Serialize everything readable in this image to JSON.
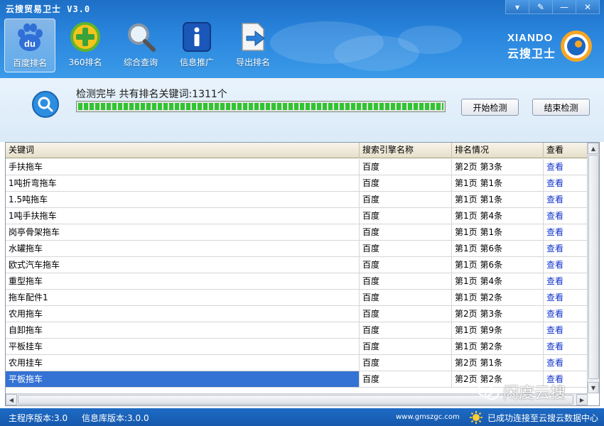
{
  "window": {
    "title": "云搜贸易卫士 V3.0",
    "controls": [
      "▾",
      "✎",
      "—",
      "✕"
    ]
  },
  "toolbar": {
    "items": [
      {
        "label": "百度排名",
        "icon": "baidu-paw-icon",
        "active": true
      },
      {
        "label": "360排名",
        "icon": "360-plus-icon",
        "active": false
      },
      {
        "label": "综合查询",
        "icon": "magnifier-icon",
        "active": false
      },
      {
        "label": "信息推广",
        "icon": "info-icon",
        "active": false
      },
      {
        "label": "导出排名",
        "icon": "export-document-icon",
        "active": false
      }
    ],
    "icon_badge": "du"
  },
  "brand": {
    "en": "XIANDO",
    "cn": "云搜卫士"
  },
  "status": {
    "message": "检测完毕 共有排名关键词:1311个",
    "progress": 1.0
  },
  "buttons": {
    "start": "开始检测",
    "stop": "结束检测"
  },
  "table": {
    "columns": [
      "关键词",
      "搜索引擎名称",
      "排名情况",
      "查看"
    ],
    "rows": [
      [
        "手扶拖车",
        "百度",
        "第2页 第3条",
        "查看"
      ],
      [
        "1吨折弯拖车",
        "百度",
        "第1页 第1条",
        "查看"
      ],
      [
        "1.5吨拖车",
        "百度",
        "第1页 第1条",
        "查看"
      ],
      [
        "1吨手扶拖车",
        "百度",
        "第1页 第4条",
        "查看"
      ],
      [
        "岗亭骨架拖车",
        "百度",
        "第1页 第1条",
        "查看"
      ],
      [
        "水罐拖车",
        "百度",
        "第1页 第6条",
        "查看"
      ],
      [
        "欧式汽车拖车",
        "百度",
        "第1页 第6条",
        "查看"
      ],
      [
        "重型拖车",
        "百度",
        "第1页 第4条",
        "查看"
      ],
      [
        "拖车配件1",
        "百度",
        "第1页 第2条",
        "查看"
      ],
      [
        "农用拖车",
        "百度",
        "第2页 第3条",
        "查看"
      ],
      [
        "自卸拖车",
        "百度",
        "第1页 第9条",
        "查看"
      ],
      [
        "平板挂车",
        "百度",
        "第1页 第2条",
        "查看"
      ],
      [
        "农用挂车",
        "百度",
        "第2页 第1条",
        "查看"
      ],
      [
        "平板拖车",
        "百度",
        "第2页 第2条",
        "查看"
      ]
    ],
    "selected_row": 13
  },
  "statusbar": {
    "main_version": "主程序版本:3.0",
    "db_version": "信息库版本:3.0.0",
    "url": "www.gmszgc.com",
    "connection": "已成功连接至云搜云数据中心"
  },
  "watermark": "闲度云搜",
  "colors": {
    "title_blue": "#2a86de",
    "statusbar_blue": "#1659ad",
    "link": "#1133cc",
    "selected": "#3472d4",
    "progress_green": "#31c431"
  }
}
